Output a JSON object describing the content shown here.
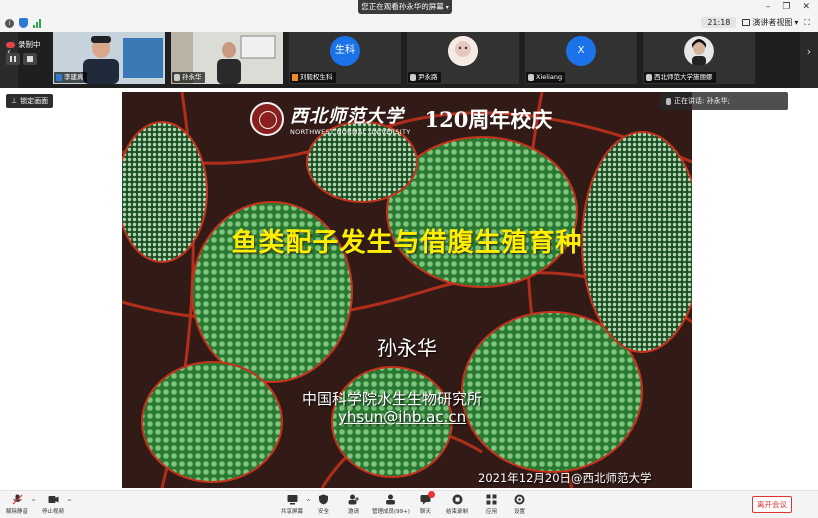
{
  "topbar": {
    "share_banner": "您正在观看孙永华的屏幕",
    "time": "21:18",
    "speaker_view": "演讲者视图"
  },
  "recording": {
    "label": "录制中"
  },
  "participants": [
    {
      "name": "李建真",
      "avatar_text": ""
    },
    {
      "name": "孙永华",
      "avatar_text": ""
    },
    {
      "name": "刘毅权生科",
      "avatar_text": "生科",
      "avatar_color": "#1a73e8"
    },
    {
      "name": "尹永路",
      "avatar_text": ""
    },
    {
      "name": "Xieliang",
      "avatar_text": "X",
      "avatar_color": "#1a73e8"
    },
    {
      "name": "西北师范大学施丽娜",
      "avatar_text": ""
    }
  ],
  "main": {
    "lock_label": "锁定画面",
    "speaking_label": "正在讲话: 孙永华;"
  },
  "slide": {
    "univ_cn": "西北师范大学",
    "univ_en": "NORTHWEST NORMAL UNIVERSITY",
    "anniversary": "120周年校庆",
    "title": "鱼类配子发生与借腹生殖育种",
    "author": "孙永华",
    "institute": "中国科学院水生生物研究所",
    "email": "yhsun@ihb.ac.cn",
    "date_place": "2021年12月20日@西北师范大学"
  },
  "toolbar": {
    "unmute": "解除静音",
    "stop_video": "停止视频",
    "share_screen": "共享屏幕",
    "security": "安全",
    "invite": "邀请",
    "manage_members": "管理成员(99+)",
    "chat": "聊天",
    "end_recording": "结束录制",
    "apps": "应用",
    "settings": "设置",
    "leave": "离开会议"
  },
  "colors": {
    "accent_blue": "#1a73e8",
    "leave_red": "#dd3333",
    "slide_title_yellow": "#ffee00"
  }
}
